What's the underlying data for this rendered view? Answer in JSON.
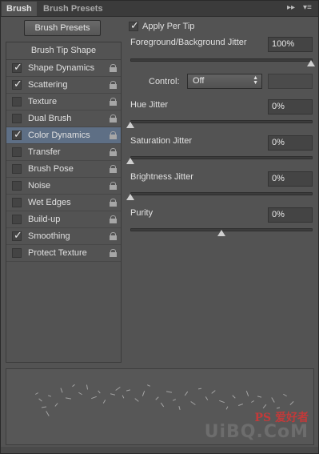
{
  "tabs": [
    {
      "label": "Brush",
      "active": true
    },
    {
      "label": "Brush Presets",
      "active": false
    }
  ],
  "tab_controls": {
    "collapse_icon": "double-chevron-right",
    "menu_icon": "panel-menu"
  },
  "brush_presets_button": "Brush Presets",
  "brush_tip_shape": "Brush Tip Shape",
  "options": [
    {
      "label": "Shape Dynamics",
      "checked": true,
      "selected": false
    },
    {
      "label": "Scattering",
      "checked": true,
      "selected": false
    },
    {
      "label": "Texture",
      "checked": false,
      "selected": false
    },
    {
      "label": "Dual Brush",
      "checked": false,
      "selected": false
    },
    {
      "label": "Color Dynamics",
      "checked": true,
      "selected": true
    },
    {
      "label": "Transfer",
      "checked": false,
      "selected": false
    },
    {
      "label": "Brush Pose",
      "checked": false,
      "selected": false
    },
    {
      "label": "Noise",
      "checked": false,
      "selected": false
    },
    {
      "label": "Wet Edges",
      "checked": false,
      "selected": false
    },
    {
      "label": "Build-up",
      "checked": false,
      "selected": false
    },
    {
      "label": "Smoothing",
      "checked": true,
      "selected": false
    },
    {
      "label": "Protect Texture",
      "checked": false,
      "selected": false
    }
  ],
  "apply_per_tip": {
    "label": "Apply Per Tip",
    "checked": true
  },
  "fg_bg_jitter": {
    "label": "Foreground/Background Jitter",
    "value": "100%",
    "level": 1.0
  },
  "control": {
    "label": "Control:",
    "value": "Off"
  },
  "hue_jitter": {
    "label": "Hue Jitter",
    "value": "0%",
    "level": 0.0
  },
  "saturation_jitter": {
    "label": "Saturation Jitter",
    "value": "0%",
    "level": 0.0
  },
  "brightness_jitter": {
    "label": "Brightness Jitter",
    "value": "0%",
    "level": 0.0
  },
  "purity": {
    "label": "Purity",
    "value": "0%",
    "level": 0.5
  },
  "watermark": {
    "line1": "PS 爱好者",
    "line2": "UiBQ.CoM"
  },
  "colors": {
    "panel": "#535353",
    "selected_row": "#5e6f85",
    "field": "#444444"
  }
}
